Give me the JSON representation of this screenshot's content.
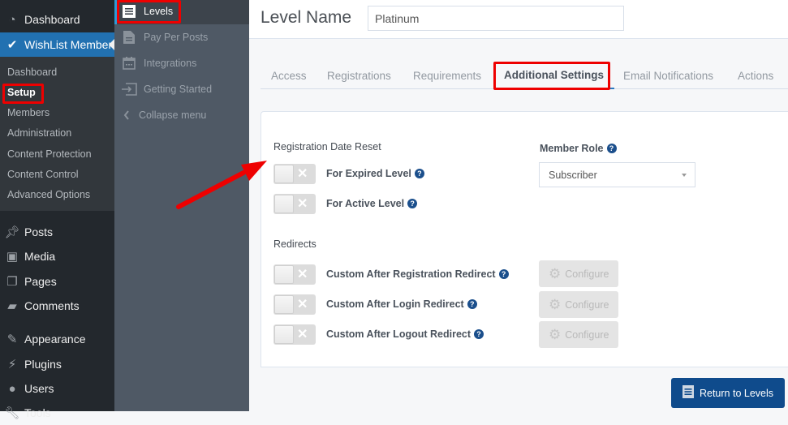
{
  "wp_menu": {
    "dashboard": "Dashboard",
    "wishlist": "WishList Member",
    "submenu": [
      "Dashboard",
      "Setup",
      "Members",
      "Administration",
      "Content Protection",
      "Content Control",
      "Advanced Options"
    ],
    "current_submenu": "Setup",
    "items": [
      {
        "label": "Posts",
        "icon": "pin-icon"
      },
      {
        "label": "Media",
        "icon": "media-icon"
      },
      {
        "label": "Pages",
        "icon": "pages-icon"
      },
      {
        "label": "Comments",
        "icon": "comment-icon"
      },
      {
        "label": "Appearance",
        "icon": "brush-icon"
      },
      {
        "label": "Plugins",
        "icon": "plug-icon"
      },
      {
        "label": "Users",
        "icon": "user-icon"
      },
      {
        "label": "Tools",
        "icon": "wrench-icon"
      }
    ]
  },
  "wl_menu": {
    "items": [
      {
        "label": "Levels",
        "icon": "list-icon",
        "current": true
      },
      {
        "label": "Pay Per Posts",
        "icon": "document-icon"
      },
      {
        "label": "Integrations",
        "icon": "calendar-icon"
      },
      {
        "label": "Getting Started",
        "icon": "sign-in-icon"
      },
      {
        "label": "Collapse menu",
        "icon": "chevron-left-icon"
      }
    ]
  },
  "header": {
    "level_name_label": "Level Name",
    "level_name_value": "Platinum"
  },
  "tabs": [
    "Access",
    "Registrations",
    "Requirements",
    "Additional Settings",
    "Email Notifications",
    "Actions"
  ],
  "active_tab": "Additional Settings",
  "settings": {
    "reg_date_reset_title": "Registration Date Reset",
    "reg_date_options": [
      {
        "label": "For Expired Level",
        "enabled": false
      },
      {
        "label": "For Active Level",
        "enabled": false
      }
    ],
    "member_role_label": "Member Role",
    "member_role_value": "Subscriber",
    "redirects_title": "Redirects",
    "redirects": [
      {
        "label": "Custom After Registration Redirect",
        "enabled": false,
        "button": "Configure"
      },
      {
        "label": "Custom After Login Redirect",
        "enabled": false,
        "button": "Configure"
      },
      {
        "label": "Custom After Logout Redirect",
        "enabled": false,
        "button": "Configure"
      }
    ]
  },
  "footer": {
    "return_label": "Return to Levels"
  },
  "colors": {
    "wp_accent": "#2271b1",
    "primary_button": "#0f4b8c",
    "highlight": "#ee0000"
  }
}
